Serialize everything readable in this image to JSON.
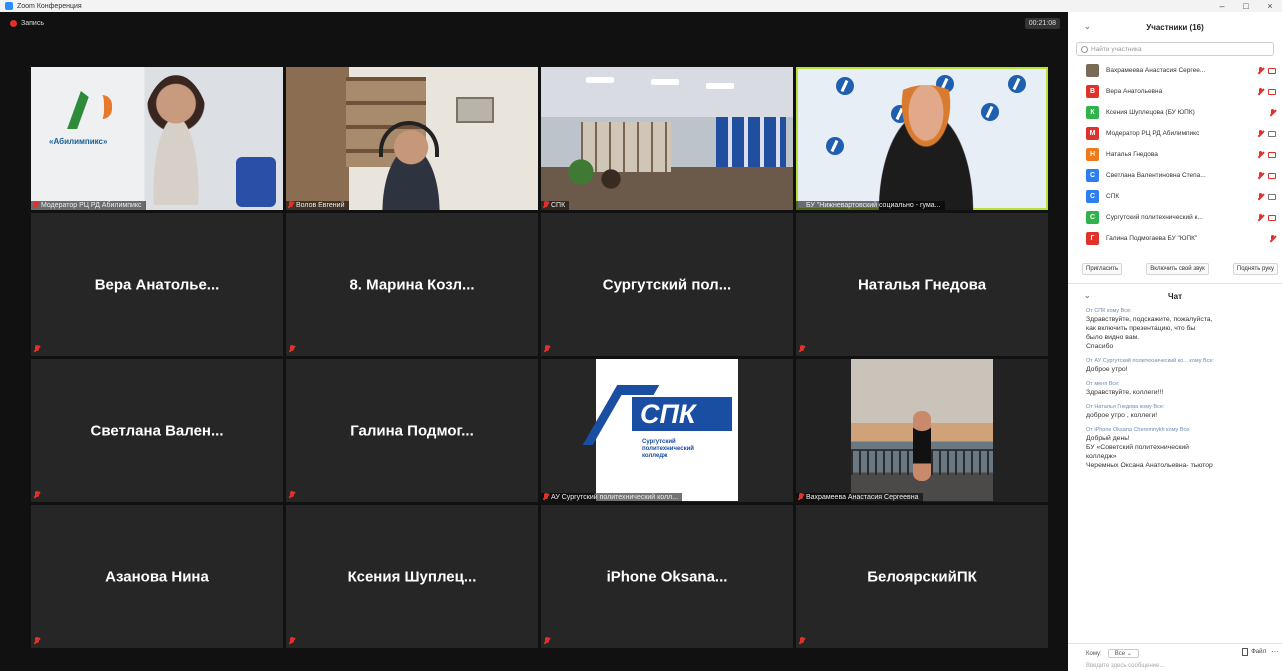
{
  "window": {
    "title": "Zoom Конференция",
    "controls": [
      "–",
      "□",
      "×"
    ]
  },
  "recording": {
    "label": "Запись"
  },
  "timer": "00:21:08",
  "video_tiles": [
    {
      "caption": "Модератор РЦ РД Абилимпикс",
      "logo": "«Абилимпикс»"
    },
    {
      "caption": "Волов Евгений"
    },
    {
      "caption": "СПК"
    },
    {
      "caption": "БУ \"Нижневартовский социально - гума..."
    }
  ],
  "name_tiles": [
    "Вера Анатолье...",
    "8. Марина Козл...",
    "Сургутский пол...",
    "Наталья Гнедова",
    "Светлана Вален...",
    "Галина Подмог...",
    "Азанова Нина",
    "Ксения Шуплец...",
    "iPhone Oksana...",
    "БелоярскийПК"
  ],
  "spk_tile": {
    "brand": "СПК",
    "sub": "Сургутский\nполитехнический\nколледж",
    "caption": "АУ Сургутский политехнический колл..."
  },
  "photo_tile": {
    "caption": "Вахрамеева Анастасия Сергеевна"
  },
  "participants": {
    "title": "Участники (16)",
    "search_placeholder": "Найти участника",
    "list": [
      {
        "initial": "",
        "name": "Вахрамеева Анастасия Сергее...",
        "color": "#7a6a58",
        "cam": "off"
      },
      {
        "initial": "В",
        "name": "Вера Анатольевна",
        "color": "#e0312b",
        "cam": "off"
      },
      {
        "initial": "К",
        "name": "Ксения Шуплецова (БУ ЮПК)",
        "color": "#2fb34a",
        "cam": "none"
      },
      {
        "initial": "М",
        "name": "Модератор РЦ РД Абилимпикс",
        "color": "#e0312b",
        "cam": "on"
      },
      {
        "initial": "Н",
        "name": "Наталья Гнедова",
        "color": "#f07a1a",
        "cam": "off"
      },
      {
        "initial": "С",
        "name": "Светлана Валентиновна Степа...",
        "color": "#2d7ef0",
        "cam": "off"
      },
      {
        "initial": "С",
        "name": "СПК",
        "color": "#2d7ef0",
        "cam": "on"
      },
      {
        "initial": "С",
        "name": "Сургутский политехнический к...",
        "color": "#2fb34a",
        "cam": "off"
      },
      {
        "initial": "Г",
        "name": "Галина Подмогаева БУ \"ЮПК\"",
        "color": "#e0312b",
        "cam": "none"
      }
    ],
    "buttons": [
      "Пригласить",
      "Включить свой звук",
      "Поднять руку"
    ]
  },
  "chat": {
    "title": "Чат",
    "messages": [
      {
        "from": "От СПК кому Все:",
        "text": "Здравствуйте, подскажите, пожалуйста,\nкак включить презентацию, что бы\nбыло видно вам.\nСпасибо"
      },
      {
        "from": "От АУ Сургутский политехнический ко... кому Все:",
        "text": "Доброе утро!"
      },
      {
        "from": "От меня Все:",
        "text": "Здравствуйте, коллеги!!!"
      },
      {
        "from": "От Наталья Гнедова кому Все:",
        "text": "доброе утро , коллеги!"
      },
      {
        "from": "От iPhone Oksana Cheremnykh кому Все:",
        "text": "Добрый день!\nБУ «Советский политехнический\nколледж»\nЧеремных Оксана Анатольевна- тьютор"
      }
    ],
    "to_label": "Кому:",
    "to_value": "Все",
    "file_label": "Файл",
    "placeholder": "Введите здесь сообщение..."
  }
}
